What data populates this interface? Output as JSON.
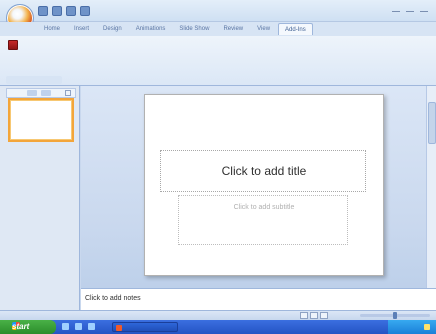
{
  "window": {
    "title": "",
    "tabs": [
      {
        "label": "Home",
        "active": false
      },
      {
        "label": "Insert",
        "active": false
      },
      {
        "label": "Design",
        "active": false
      },
      {
        "label": "Animations",
        "active": false
      },
      {
        "label": "Slide Show",
        "active": false
      },
      {
        "label": "Review",
        "active": false
      },
      {
        "label": "View",
        "active": false
      },
      {
        "label": "Add-Ins",
        "active": true
      }
    ]
  },
  "ribbon": {
    "command_label": "",
    "group_label": ""
  },
  "left_panel": {
    "slide_number": ""
  },
  "slide": {
    "title_placeholder": "Click to add title",
    "subtitle_placeholder": "Click to add subtitle"
  },
  "notes": {
    "placeholder": "Click to add notes"
  },
  "statusbar": {
    "slide_info": "",
    "theme": "",
    "language": ""
  },
  "taskbar": {
    "start_label": "start",
    "window_button": ""
  },
  "colors": {
    "accent": "#f3a53a",
    "ribbon": "#dbe7f6",
    "taskbar": "#2454c4",
    "start": "#2b8d2b"
  }
}
